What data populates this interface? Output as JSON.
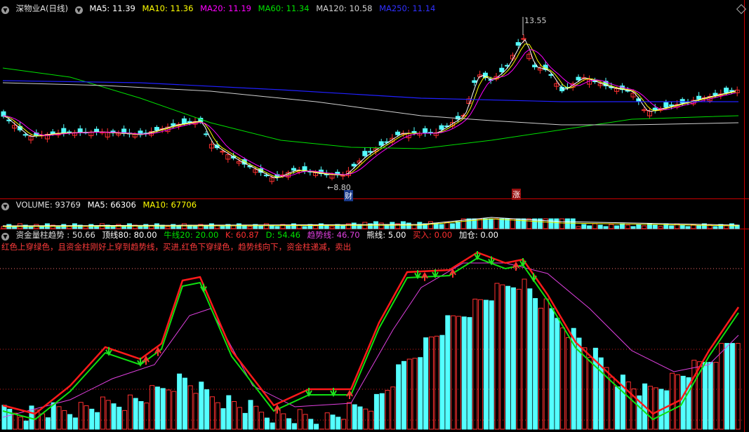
{
  "colors": {
    "up": "#ff3030",
    "down": "#54ffff",
    "ma5": "#ffffff",
    "ma10": "#ffff00",
    "ma20": "#ff00ff",
    "ma60": "#00e000",
    "ma120": "#d0d0d0",
    "ma250": "#2020ff",
    "red_line": "#ff1a1a",
    "green_line": "#10e010",
    "magenta_line": "#e040e0",
    "divider": "#cc0000"
  },
  "price_panel": {
    "title": "深物业A(日线)",
    "ma5": {
      "label": "MA5:",
      "value": "11.39"
    },
    "ma10": {
      "label": "MA10:",
      "value": "11.36"
    },
    "ma20": {
      "label": "MA20:",
      "value": "11.19"
    },
    "ma60": {
      "label": "MA60:",
      "value": "11.34"
    },
    "ma120": {
      "label": "MA120:",
      "value": "10.58"
    },
    "ma250": {
      "label": "MA250:",
      "value": "11.14"
    },
    "high_marker": "13.55",
    "low_marker": "←8.80",
    "badge_cai": "财",
    "badge_zhang": "涨"
  },
  "volume_panel": {
    "title": "VOLUME:",
    "value": "93769",
    "ma5": {
      "label": "MA5:",
      "value": "66306"
    },
    "ma10": {
      "label": "MA10:",
      "value": "67706"
    }
  },
  "indicator_panel": {
    "title": "资金量柱趋势 :",
    "value": "50.66",
    "top_line": {
      "label": "顶线80:",
      "value": "80.00"
    },
    "bull_line": {
      "label": "牛线20:",
      "value": "20.00"
    },
    "k": {
      "label": "K:",
      "value": "60.87"
    },
    "d": {
      "label": "D:",
      "value": "54.46"
    },
    "trend": {
      "label": "趋势线:",
      "value": "46.70"
    },
    "bear": {
      "label": "熊线:",
      "value": "5.00"
    },
    "buy": {
      "label": "买入:",
      "value": "0.00"
    },
    "add": {
      "label": "加仓:",
      "value": "0.00"
    },
    "note": "红色上穿绿色，且资金柱刚好上穿到趋势线，买进,红色下穿绿色，趋势线向下，资金柱递减，卖出"
  }
}
